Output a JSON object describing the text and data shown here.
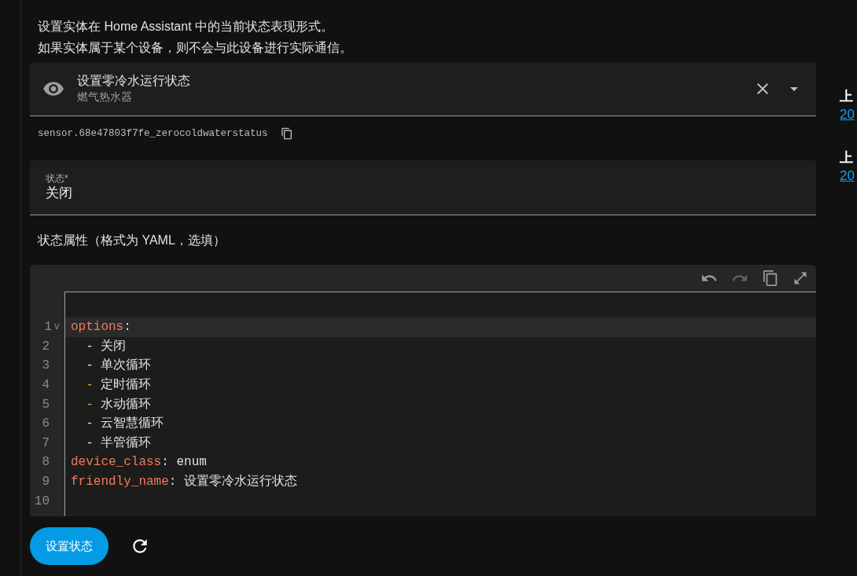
{
  "description": [
    "设置实体在 Home Assistant 中的当前状态表现形式。",
    "如果实体属于某个设备，则不会与此设备进行实际通信。"
  ],
  "entity_picker": {
    "title": "设置零冷水运行状态",
    "subtitle": "燃气热水器"
  },
  "entity_id": "sensor.68e47803f7fe_zerocoldwaterstatus",
  "state_field": {
    "label": "状态*",
    "value": "关闭"
  },
  "attributes_label": "状态属性（格式为 YAML，选填）",
  "editor": {
    "lines": [
      {
        "number": "1",
        "fold": "v",
        "active": true,
        "tokens": [
          {
            "kind": "key",
            "text": "options"
          },
          {
            "kind": "punct",
            "text": ":"
          }
        ]
      },
      {
        "number": "2",
        "active": false,
        "tokens": [
          {
            "kind": "dash",
            "text": "  - "
          },
          {
            "kind": "text",
            "text": "关闭"
          }
        ]
      },
      {
        "number": "3",
        "active": false,
        "tokens": [
          {
            "kind": "dash",
            "text": "  - "
          },
          {
            "kind": "text",
            "text": "单次循环"
          }
        ]
      },
      {
        "number": "4",
        "active": false,
        "tokens": [
          {
            "kind": "dash-warm",
            "text": "  - "
          },
          {
            "kind": "text",
            "text": "定时循环"
          }
        ]
      },
      {
        "number": "5",
        "active": false,
        "tokens": [
          {
            "kind": "dash-warm",
            "text": "  - "
          },
          {
            "kind": "text",
            "text": "水动循环"
          }
        ]
      },
      {
        "number": "6",
        "active": false,
        "tokens": [
          {
            "kind": "dash",
            "text": "  - "
          },
          {
            "kind": "text",
            "text": "云智慧循环"
          }
        ]
      },
      {
        "number": "7",
        "active": false,
        "tokens": [
          {
            "kind": "dash",
            "text": "  - "
          },
          {
            "kind": "text",
            "text": "半管循环"
          }
        ]
      },
      {
        "number": "8",
        "active": false,
        "tokens": [
          {
            "kind": "key",
            "text": "device_class"
          },
          {
            "kind": "punct",
            "text": ": "
          },
          {
            "kind": "text",
            "text": "enum"
          }
        ]
      },
      {
        "number": "9",
        "active": false,
        "tokens": [
          {
            "kind": "key",
            "text": "friendly_name"
          },
          {
            "kind": "punct",
            "text": ": "
          },
          {
            "kind": "text",
            "text": "设置零冷水运行状态"
          }
        ]
      },
      {
        "number": "10",
        "active": false
      }
    ]
  },
  "set_button": "设置状态",
  "side": [
    {
      "heading": "上",
      "link": "20"
    },
    {
      "heading": "上",
      "link": "20"
    }
  ]
}
